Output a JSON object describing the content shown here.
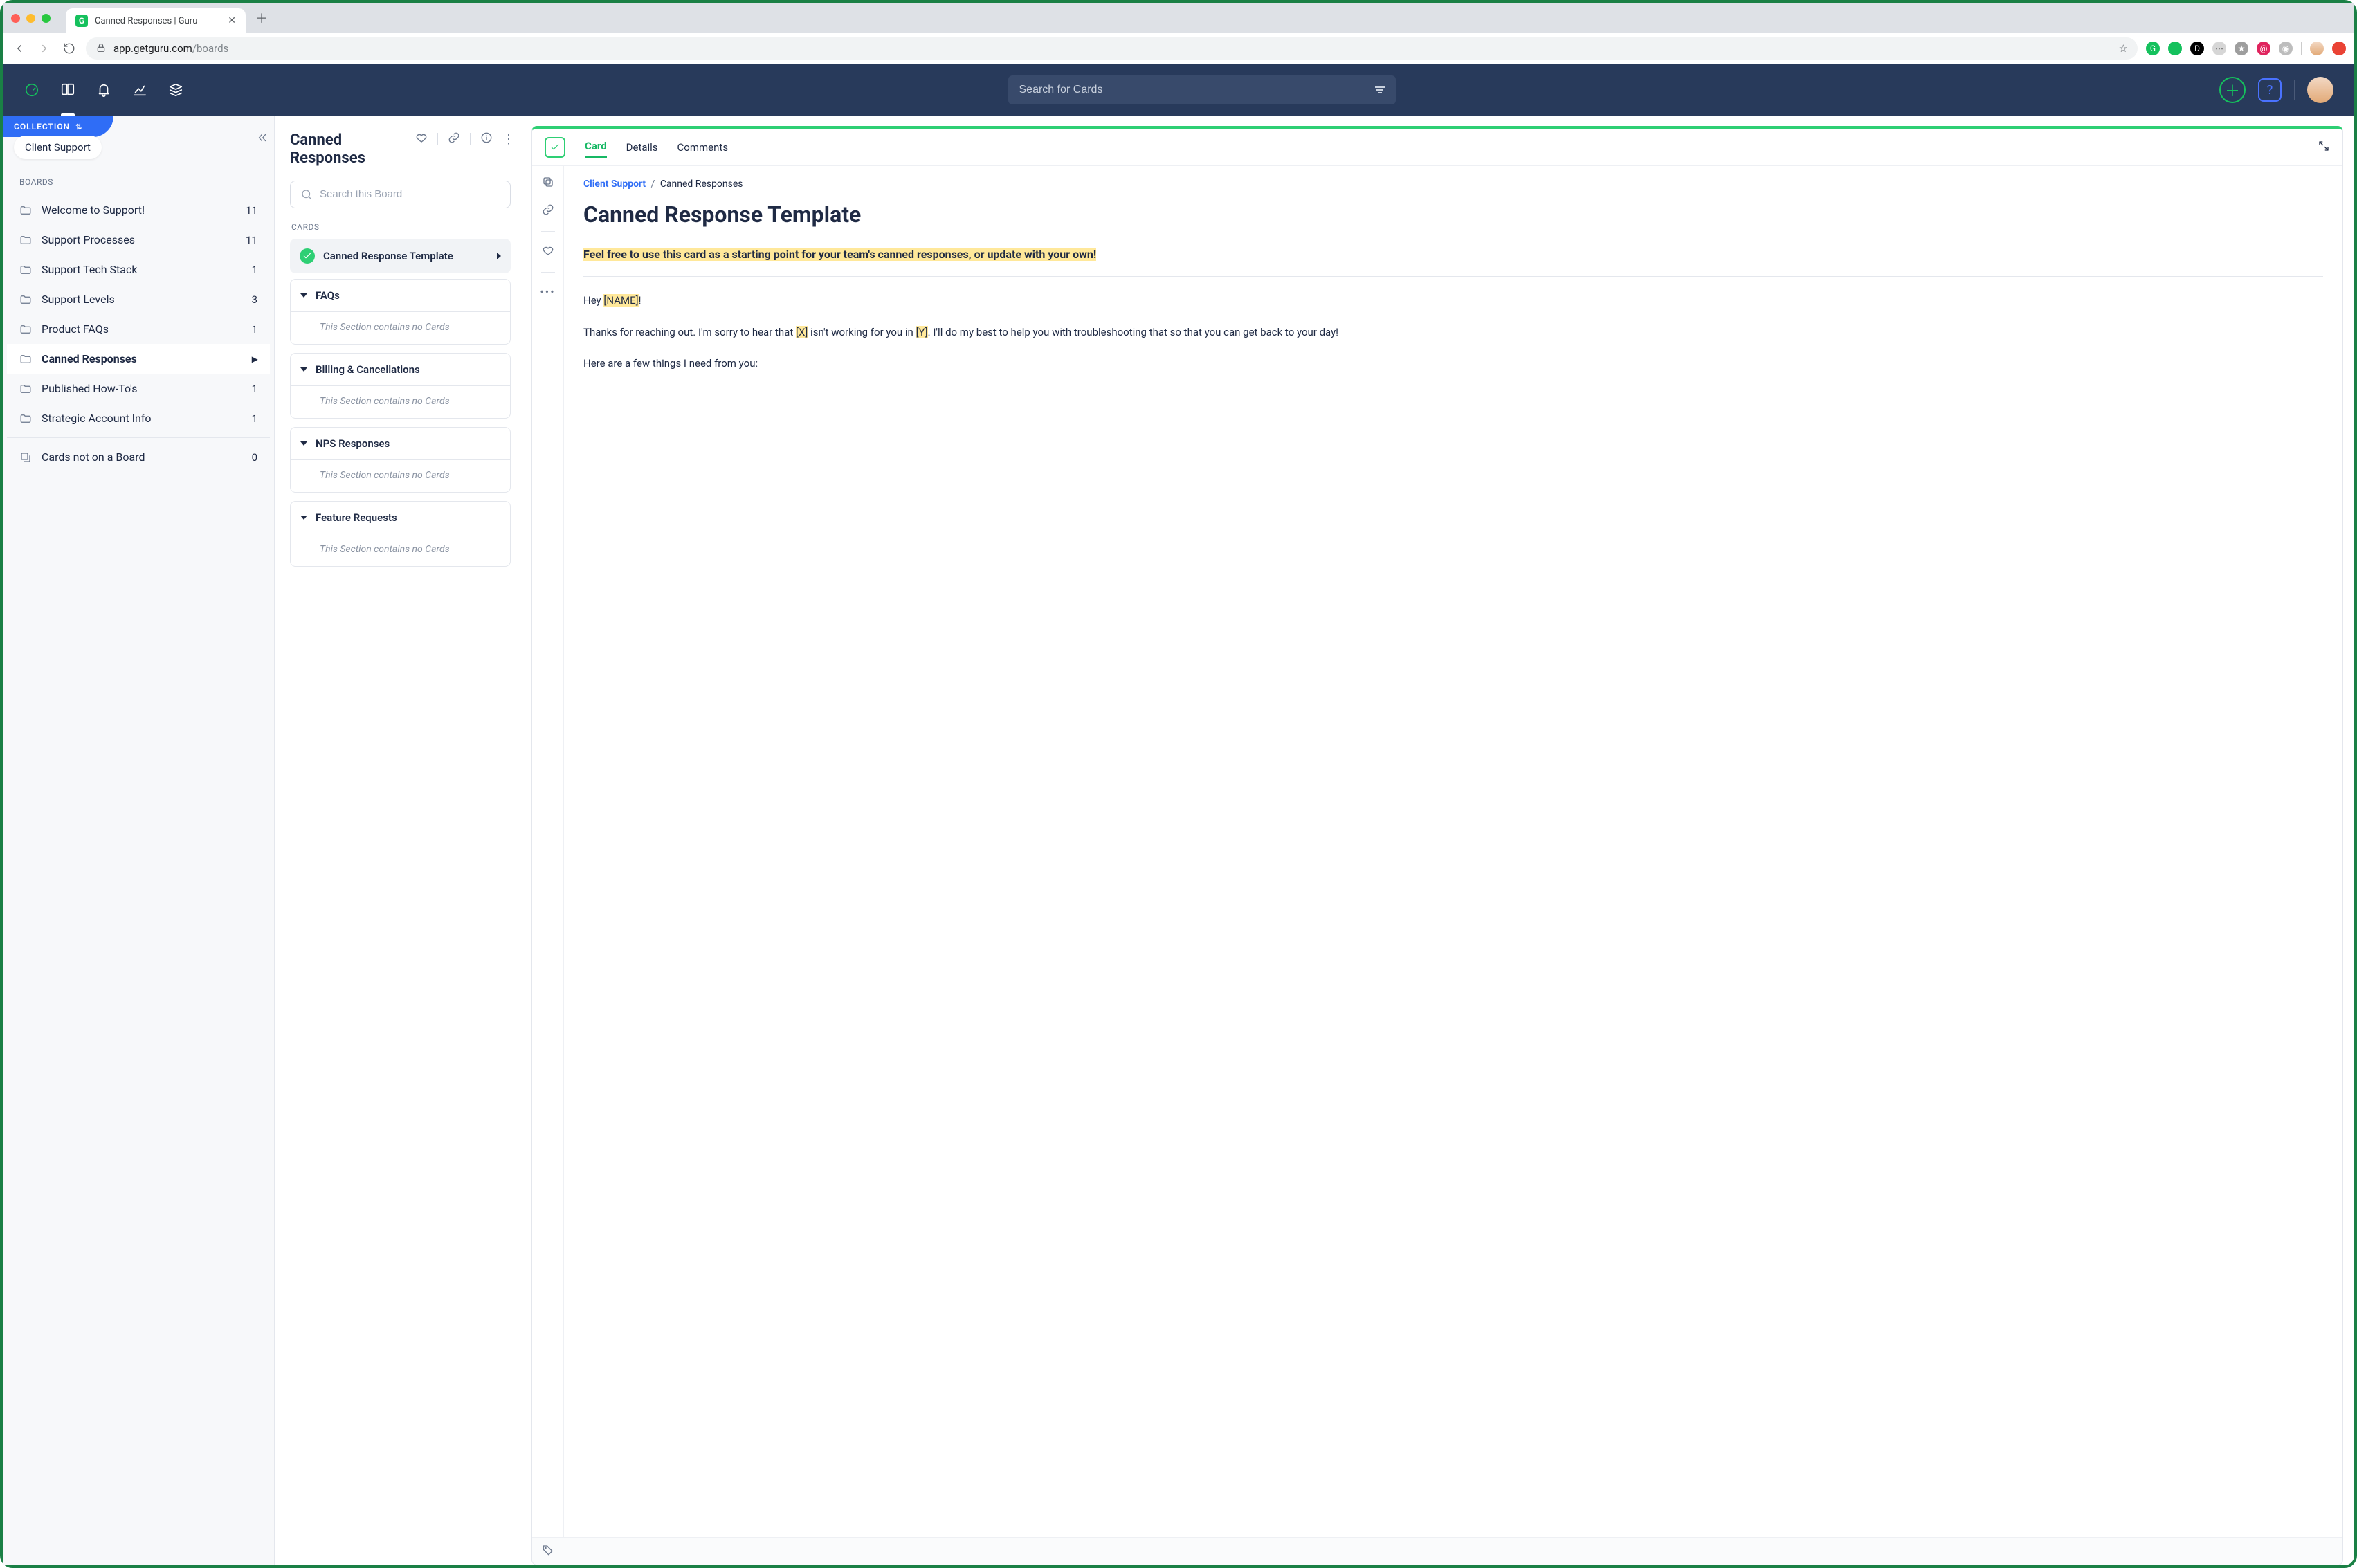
{
  "browser": {
    "tab_title": "Canned Responses | Guru",
    "url_host": "app.getguru.com",
    "url_path": "/boards"
  },
  "app": {
    "search_placeholder": "Search for Cards"
  },
  "sidebar": {
    "collection_label": "COLLECTION",
    "collection_name": "Client Support",
    "boards_label": "BOARDS",
    "boards": [
      {
        "name": "Welcome to Support!",
        "count": "11"
      },
      {
        "name": "Support Processes",
        "count": "11"
      },
      {
        "name": "Support Tech Stack",
        "count": "1"
      },
      {
        "name": "Support Levels",
        "count": "3"
      },
      {
        "name": "Product FAQs",
        "count": "1"
      },
      {
        "name": "Canned Responses",
        "active": true
      },
      {
        "name": "Published How-To's",
        "count": "1"
      },
      {
        "name": "Strategic Account Info",
        "count": "1"
      }
    ],
    "not_on_board": {
      "label": "Cards not on a Board",
      "count": "0"
    }
  },
  "middle": {
    "title": "Canned Responses",
    "search_placeholder": "Search this Board",
    "cards_label": "CARDS",
    "selected": "Canned Response Template",
    "empty_msg": "This Section contains no Cards",
    "sections": [
      {
        "name": "FAQs"
      },
      {
        "name": "Billing & Cancellations"
      },
      {
        "name": "NPS Responses"
      },
      {
        "name": "Feature Requests"
      }
    ]
  },
  "preview": {
    "tabs": {
      "card": "Card",
      "details": "Details",
      "comments": "Comments"
    },
    "crumb_collection": "Client Support",
    "crumb_board": "Canned Responses",
    "title": "Canned Response Template",
    "intro": "Feel free to use this card as a starting point for your team's canned responses, or update with your own!",
    "greet_pre": "Hey ",
    "greet_ph": "[NAME]",
    "greet_post": "!",
    "p2_a": "Thanks for reaching out. I'm sorry to hear that ",
    "p2_x": "[X]",
    "p2_b": " isn't working for you in ",
    "p2_y": "[Y]",
    "p2_c": ". I'll do my best to help you with troubleshooting that so that you can get back to your day!",
    "p3": "Here are a few things I need from you:"
  }
}
